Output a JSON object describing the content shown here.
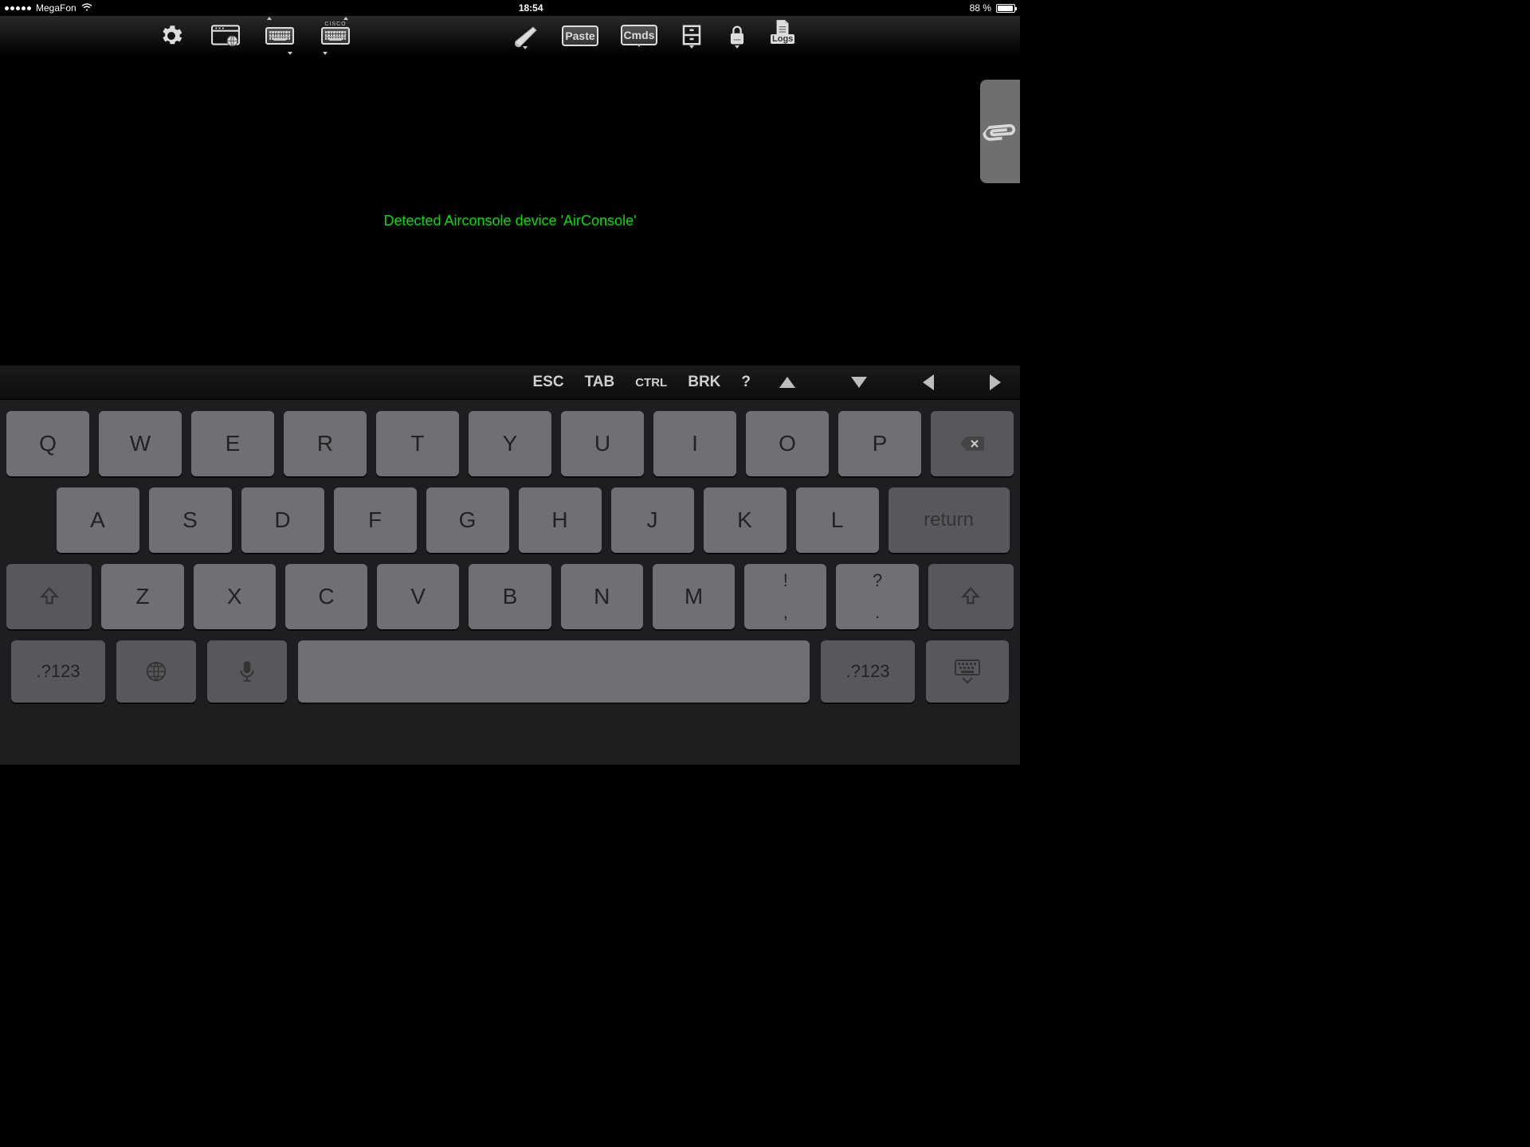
{
  "status": {
    "signal_dots": 5,
    "carrier": "MegaFon",
    "time": "18:54",
    "battery_text": "88 %",
    "battery_level": 0.88
  },
  "toolbar": {
    "left_icons": [
      "settings",
      "browser",
      "keyboard-swap",
      "cisco-keyboard"
    ],
    "right_icons": [
      "scripts",
      "paste",
      "cmds",
      "files",
      "lock",
      "logs"
    ],
    "paste_label": "Paste",
    "cmds_label": "Cmds",
    "logs_label": "Logs",
    "cisco_label": "CISCO"
  },
  "terminal": {
    "message": "Detected Airconsole device 'AirConsole'"
  },
  "side_tab": {
    "name": "clip"
  },
  "assist": {
    "esc": "ESC",
    "tab": "TAB",
    "ctrl": "CTRL",
    "brk": "BRK",
    "help": "?"
  },
  "keyboard": {
    "row1": [
      "Q",
      "W",
      "E",
      "R",
      "T",
      "Y",
      "U",
      "I",
      "O",
      "P"
    ],
    "row2": [
      "A",
      "S",
      "D",
      "F",
      "G",
      "H",
      "J",
      "K",
      "L"
    ],
    "return": "return",
    "row3": [
      "Z",
      "X",
      "C",
      "V",
      "B",
      "N",
      "M"
    ],
    "punct1_top": "!",
    "punct1_bot": ",",
    "punct2_top": "?",
    "punct2_bot": ".",
    "numtoggle": ".?123"
  }
}
